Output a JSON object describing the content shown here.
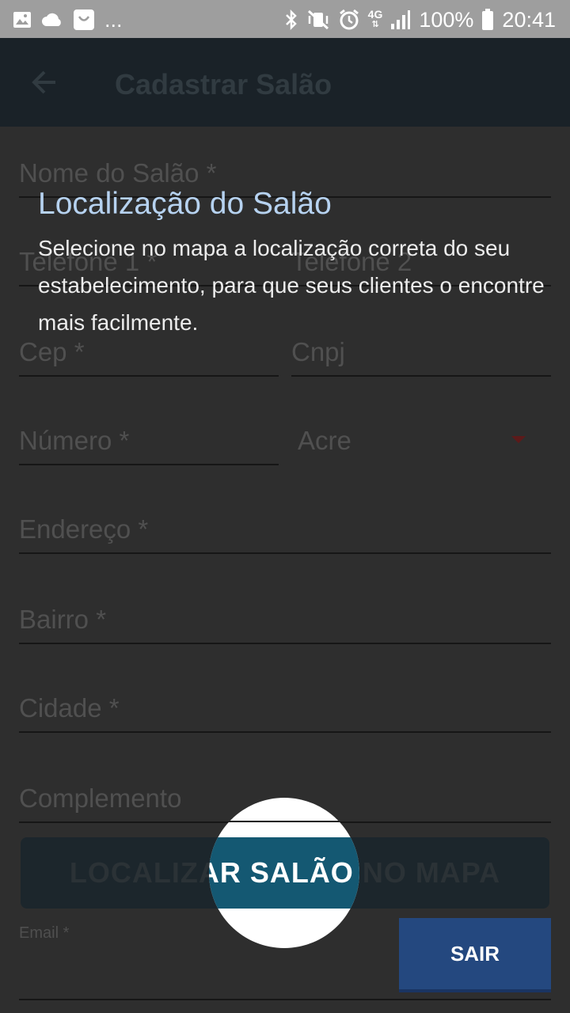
{
  "status_bar": {
    "overflow": "...",
    "network": "4G",
    "battery": "100%",
    "time": "20:41",
    "icons_left": [
      "image-icon",
      "cloud-icon",
      "shop-bag-icon"
    ],
    "icons_right": [
      "bluetooth-icon",
      "vibrate-mute-icon",
      "alarm-icon",
      "network-4g-icon",
      "signal-icon",
      "battery-icon"
    ]
  },
  "app_bar": {
    "title": "Cadastrar Salão",
    "back_icon": "arrow-left-icon"
  },
  "form": {
    "nome": "Nome do Salão *",
    "telefone1": "Telefone 1 *",
    "telefone2": "Telefone 2",
    "cep": "Cep *",
    "cnpj": "Cnpj",
    "numero": "Número *",
    "estado": "Acre",
    "endereco": "Endereço *",
    "bairro": "Bairro *",
    "cidade": "Cidade *",
    "complemento": "Complemento",
    "map_button": "LOCALIZAR SALÃO NO MAPA",
    "email": "Email *"
  },
  "tutorial": {
    "title": "Localização do Salão",
    "description": "Selecione no mapa a localização correta do seu estabelecimento, para que seus clientes o encontre mais facilmente.",
    "exit_button": "SAIR"
  },
  "colors": {
    "status_bar": "#9e9e9e",
    "app_bar": "#1a2228",
    "accent_button": "#145872",
    "exit_button": "#24487f",
    "tutorial_title": "#b6d2f0"
  }
}
